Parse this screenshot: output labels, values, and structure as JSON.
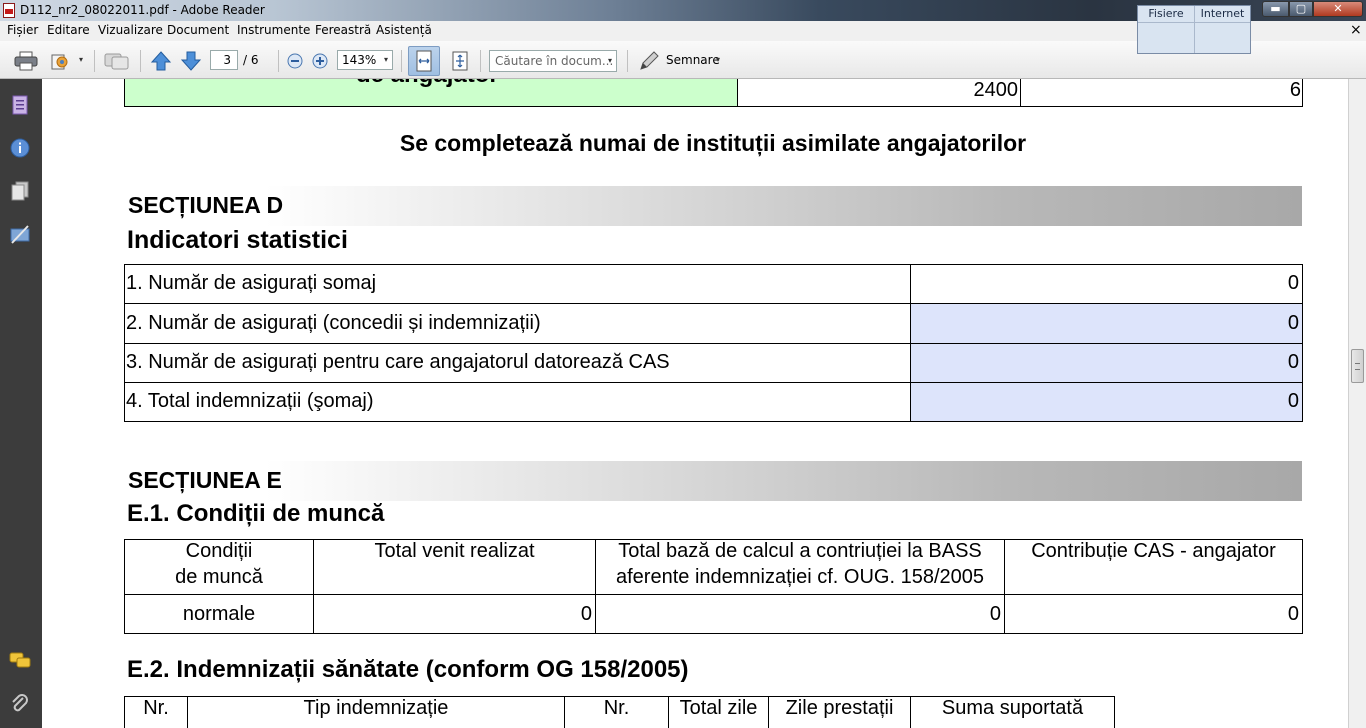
{
  "window": {
    "title": "D112_nr2_08022011.pdf - Adobe Reader",
    "minimize": "▬",
    "maximize": "▢",
    "close": "✕"
  },
  "floating_panel": {
    "tabs": [
      "Fisiere",
      "Internet"
    ]
  },
  "menu": {
    "items": [
      "Fișier",
      "Editare",
      "Vizualizare",
      "Document",
      "Instrumente",
      "Fereastră",
      "Asistență"
    ],
    "close": "×"
  },
  "toolbar": {
    "page_current": "3",
    "page_total": "/ 6",
    "zoom": "143%",
    "search_placeholder": "Căutare în docum...",
    "sign_label": "Semnare",
    "dropdown": "▾"
  },
  "document": {
    "top_row": {
      "label": "de angajator",
      "value1": "2400",
      "value2": "6"
    },
    "notice": "Se completează numai de instituții asimilate angajatorilor",
    "section_d": {
      "title": "SECȚIUNEA D",
      "subtitle": "Indicatori statistici",
      "rows": [
        {
          "label": "1. Număr de asigurați somaj",
          "value": "0"
        },
        {
          "label": "2. Număr de asigurați (concedii și indemnizații)",
          "value": "0"
        },
        {
          "label": "3. Număr de asigurați pentru care angajatorul datorează CAS",
          "value": "0"
        },
        {
          "label": "4. Total indemnizații (şomaj)",
          "value": "0"
        }
      ]
    },
    "section_e": {
      "title": "SECȚIUNEA E",
      "e1_title": "E.1. Condiții de muncă",
      "e1_headers": [
        "Condiții",
        "de muncă",
        "Total venit realizat",
        "Total bază de calcul a contriuției la BASS",
        "aferente indemnizației cf. OUG. 158/2005",
        "Contribuție CAS - angajator"
      ],
      "e1_row": [
        "normale",
        "0",
        "0",
        "0"
      ],
      "e2_title": "E.2. Indemnizații sănătate (conform OG 158/2005)",
      "e2_headers": [
        "Nr.",
        "Tip indemnizație",
        "Nr.",
        "Total zile",
        "Zile prestații",
        "Suma suportată"
      ]
    }
  },
  "colors": {
    "green_cell": "#ccffcc",
    "blue_cell": "#dde4fb",
    "left_nav": "#3c3c3c"
  }
}
